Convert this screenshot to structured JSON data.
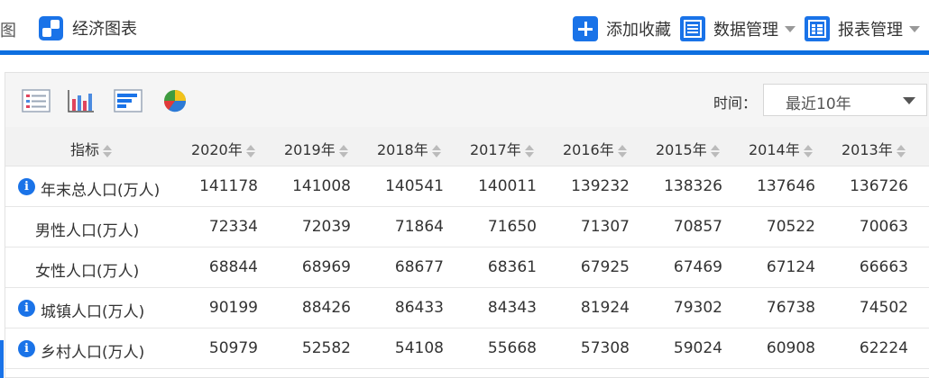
{
  "topbar": {
    "left_fragment": "图",
    "tab_label": "经济图表",
    "actions": {
      "favorite": "添加收藏",
      "data_manage": "数据管理",
      "report_manage": "报表管理"
    }
  },
  "toolbar": {
    "time_label": "时间：",
    "time_select_value": "最近10年"
  },
  "table": {
    "indicator_header": "指标",
    "years": [
      "2020年",
      "2019年",
      "2018年",
      "2017年",
      "2016年",
      "2015年",
      "2014年",
      "2013年"
    ],
    "rows": [
      {
        "name": "年末总人口(万人)",
        "info": true,
        "values": [
          "141178",
          "141008",
          "140541",
          "140011",
          "139232",
          "138326",
          "137646",
          "136726"
        ]
      },
      {
        "name": "男性人口(万人)",
        "info": false,
        "values": [
          "72334",
          "72039",
          "71864",
          "71650",
          "71307",
          "70857",
          "70522",
          "70063"
        ]
      },
      {
        "name": "女性人口(万人)",
        "info": false,
        "values": [
          "68844",
          "68969",
          "68677",
          "68361",
          "67925",
          "67469",
          "67124",
          "66663"
        ]
      },
      {
        "name": "城镇人口(万人)",
        "info": true,
        "values": [
          "90199",
          "88426",
          "86433",
          "84343",
          "81924",
          "79302",
          "76738",
          "74502"
        ]
      },
      {
        "name": "乡村人口(万人)",
        "info": true,
        "values": [
          "50979",
          "52582",
          "54108",
          "55668",
          "57308",
          "59024",
          "60908",
          "62224"
        ]
      }
    ]
  },
  "colors": {
    "accent": "#1a73e8",
    "header_bg": "#f2f2f2",
    "toolbar_bg": "#f5f5f5"
  }
}
